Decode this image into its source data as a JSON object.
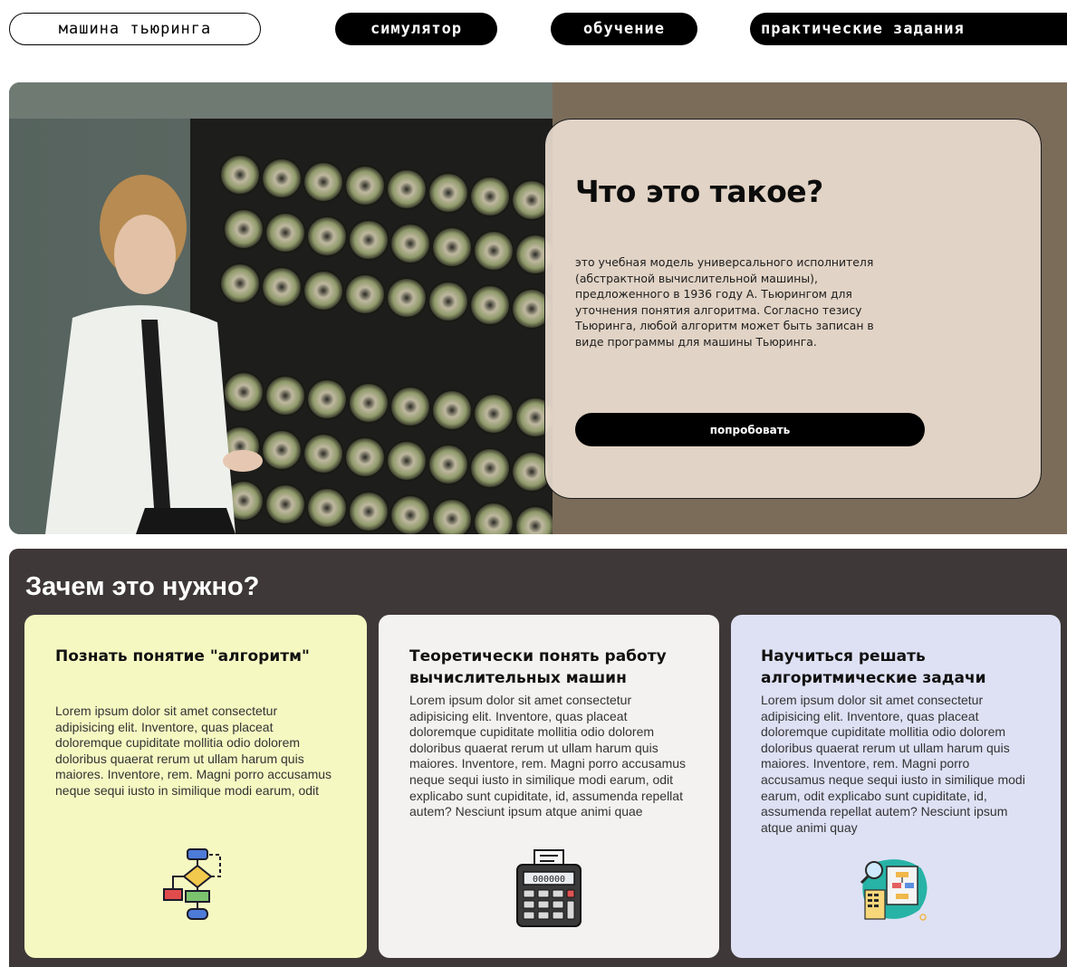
{
  "nav": {
    "brand": "машина тьюринга",
    "links": [
      "симулятор",
      "обучение",
      "практические задания"
    ]
  },
  "hero": {
    "title": "Что это такое?",
    "text": "это учебная модель универсального исполнителя (абстрактной вычислительной машины), предложенного в 1936 году А. Тьюрингом для уточнения понятия алгоритма. Согласно тезису Тьюринга, любой алгоритм может быть записан в виде программы для машины Тьюринга.",
    "button": "попробовать"
  },
  "section": {
    "title": "Зачем это нужно?",
    "cards": [
      {
        "title": "Познать понятие \"алгоритм\"",
        "text": "Lorem ipsum dolor sit amet consectetur adipisicing elit. Inventore, quas placeat doloremque cupiditate mollitia odio dolorem doloribus quaerat rerum ut ullam harum quis maiores. Inventore, rem. Magni porro accusamus neque sequi iusto in similique modi earum, odit",
        "icon": "flowchart-icon"
      },
      {
        "title": "Теоретически понять работу вычислительных машин",
        "text": "Lorem ipsum dolor sit amet consectetur adipisicing elit. Inventore, quas placeat doloremque cupiditate mollitia odio dolorem doloribus quaerat rerum ut ullam harum quis maiores. Inventore, rem. Magni porro accusamus neque sequi iusto in similique modi earum, odit explicabo sunt cupiditate, id, assumenda repellat autem? Nesciunt ipsum atque animi quae",
        "icon": "calculator-icon",
        "display": "000000"
      },
      {
        "title": "Научиться решать алгоритмические задачи",
        "text": "Lorem ipsum dolor sit amet consectetur adipisicing elit. Inventore, quas placeat doloremque cupiditate mollitia odio dolorem doloribus quaerat rerum ut ullam harum quis maiores. Inventore, rem. Magni porro accusamus neque sequi iusto in similique modi earum, odit explicabo sunt cupiditate, id, assumenda repellat autem? Nesciunt ipsum atque animi quay",
        "icon": "algorithm-analysis-icon"
      }
    ]
  }
}
